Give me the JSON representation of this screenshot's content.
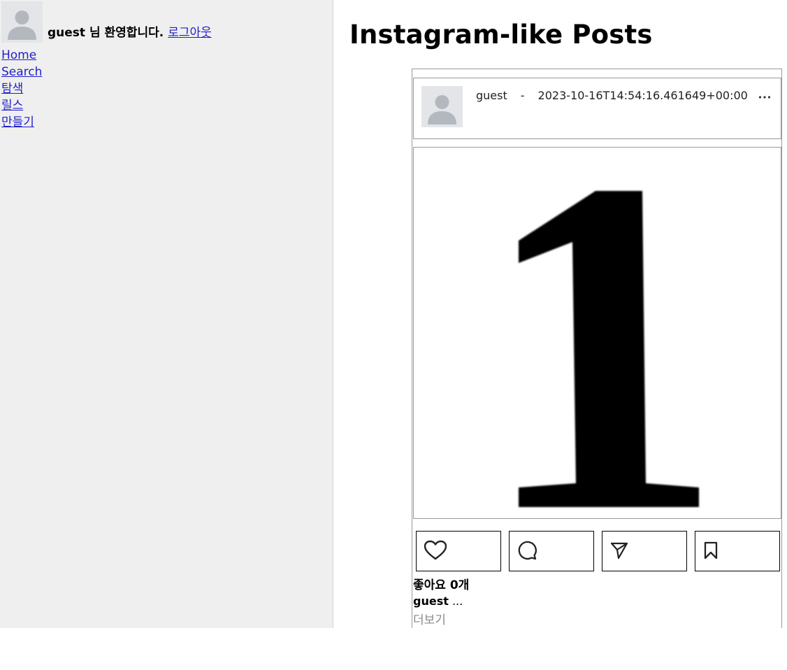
{
  "sidebar": {
    "avatar_icon": "default-user-avatar-icon",
    "username": "guest",
    "welcome_suffix": "님 환영합니다.",
    "logout_label": "로그아웃",
    "nav": [
      {
        "label": "Home"
      },
      {
        "label": "Search"
      },
      {
        "label": "탐색"
      },
      {
        "label": "릴스"
      },
      {
        "label": "만들기"
      }
    ]
  },
  "main": {
    "title": "Instagram-like Posts"
  },
  "post": {
    "author": "guest",
    "separator": "-",
    "timestamp": "2023-10-16T14:54:16.461649+00:00",
    "more_icon": "more-horizontal-icon",
    "image_content": "1",
    "actions": [
      {
        "icon": "heart-icon"
      },
      {
        "icon": "comment-icon"
      },
      {
        "icon": "send-icon"
      },
      {
        "icon": "bookmark-icon"
      }
    ],
    "likes_label": "좋아요 0개",
    "caption_user": "guest",
    "caption_text": "...",
    "more_label": "더보기"
  },
  "colors": {
    "sidebar_bg": "#efefef",
    "link": "#1f1fcc",
    "avatar_bg": "#e3e5e8",
    "avatar_fg": "#b3b8bf",
    "border": "#9a9a9a",
    "muted": "#8a8a8a"
  }
}
